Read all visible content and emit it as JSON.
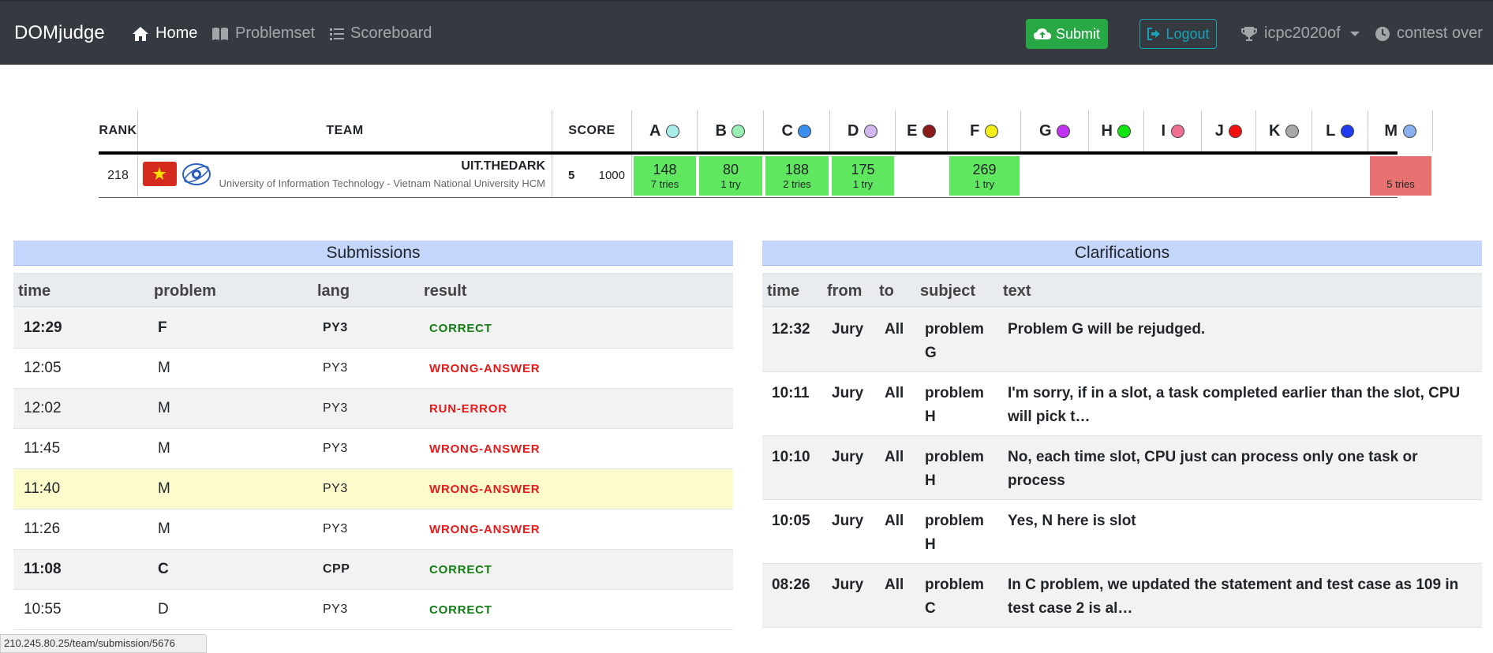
{
  "nav": {
    "brand": "DOMjudge",
    "links": [
      {
        "label": "Home",
        "icon": "home-icon"
      },
      {
        "label": "Problemset",
        "icon": "book-icon"
      },
      {
        "label": "Scoreboard",
        "icon": "list-icon"
      }
    ],
    "submit_label": "Submit",
    "logout_label": "Logout",
    "contest": "icpc2020of",
    "status": "contest over"
  },
  "scoreboard": {
    "headers": {
      "rank": "RANK",
      "team": "TEAM",
      "score": "SCORE"
    },
    "problems": [
      {
        "label": "A",
        "color": "#a8ecec"
      },
      {
        "label": "B",
        "color": "#9af0b4"
      },
      {
        "label": "C",
        "color": "#3b8ff0"
      },
      {
        "label": "D",
        "color": "#d2b8f0"
      },
      {
        "label": "E",
        "color": "#8b1a1a"
      },
      {
        "label": "F",
        "color": "#f5ee1a"
      },
      {
        "label": "G",
        "color": "#c133f0"
      },
      {
        "label": "H",
        "color": "#12e612"
      },
      {
        "label": "I",
        "color": "#f07094"
      },
      {
        "label": "J",
        "color": "#f01010"
      },
      {
        "label": "K",
        "color": "#a8a8a8"
      },
      {
        "label": "L",
        "color": "#1f3cf0"
      },
      {
        "label": "M",
        "color": "#8ab0f0"
      }
    ],
    "row": {
      "rank": "218",
      "team_name": "UIT.THEDARK",
      "affiliation": "University of Information Technology - Vietnam National University HCM",
      "solved": "5",
      "penalty": "1000",
      "cells": [
        {
          "time": "148",
          "tries": "7 tries",
          "state": "solved"
        },
        {
          "time": "80",
          "tries": "1 try",
          "state": "solved"
        },
        {
          "time": "188",
          "tries": "2 tries",
          "state": "solved"
        },
        {
          "time": "175",
          "tries": "1 try",
          "state": "solved"
        },
        {
          "time": "",
          "tries": "",
          "state": "none"
        },
        {
          "time": "269",
          "tries": "1 try",
          "state": "solved"
        },
        {
          "time": "",
          "tries": "",
          "state": "none"
        },
        {
          "time": "",
          "tries": "",
          "state": "none"
        },
        {
          "time": "",
          "tries": "",
          "state": "none"
        },
        {
          "time": "",
          "tries": "",
          "state": "none"
        },
        {
          "time": "",
          "tries": "",
          "state": "none"
        },
        {
          "time": "",
          "tries": "",
          "state": "none"
        },
        {
          "time": "",
          "tries": "5 tries",
          "state": "failed"
        }
      ]
    }
  },
  "submissions": {
    "title": "Submissions",
    "columns": [
      "time",
      "problem",
      "lang",
      "result"
    ],
    "rows": [
      {
        "time": "12:29",
        "problem": "F",
        "lang": "PY3",
        "result": "CORRECT",
        "ok": true,
        "bold": true
      },
      {
        "time": "12:05",
        "problem": "M",
        "lang": "PY3",
        "result": "WRONG-ANSWER",
        "ok": false,
        "bold": false
      },
      {
        "time": "12:02",
        "problem": "M",
        "lang": "PY3",
        "result": "RUN-ERROR",
        "ok": false,
        "bold": false
      },
      {
        "time": "11:45",
        "problem": "M",
        "lang": "PY3",
        "result": "WRONG-ANSWER",
        "ok": false,
        "bold": false
      },
      {
        "time": "11:40",
        "problem": "M",
        "lang": "PY3",
        "result": "WRONG-ANSWER",
        "ok": false,
        "bold": false
      },
      {
        "time": "11:26",
        "problem": "M",
        "lang": "PY3",
        "result": "WRONG-ANSWER",
        "ok": false,
        "bold": false
      },
      {
        "time": "11:08",
        "problem": "C",
        "lang": "CPP",
        "result": "CORRECT",
        "ok": true,
        "bold": true
      },
      {
        "time": "10:55",
        "problem": "D",
        "lang": "PY3",
        "result": "CORRECT",
        "ok": true,
        "bold": false
      }
    ]
  },
  "clarifications": {
    "title": "Clarifications",
    "columns": [
      "time",
      "from",
      "to",
      "subject",
      "text"
    ],
    "rows": [
      {
        "time": "12:32",
        "from": "Jury",
        "to": "All",
        "subject": "problem G",
        "text": "Problem G will be rejudged."
      },
      {
        "time": "10:11",
        "from": "Jury",
        "to": "All",
        "subject": "problem H",
        "text": "I'm sorry, if in a slot, a task completed earlier than the slot, CPU will pick t…"
      },
      {
        "time": "10:10",
        "from": "Jury",
        "to": "All",
        "subject": "problem H",
        "text": "No, each time slot, CPU just can process only one task or process"
      },
      {
        "time": "10:05",
        "from": "Jury",
        "to": "All",
        "subject": "problem H",
        "text": "Yes, N here is slot"
      },
      {
        "time": "08:26",
        "from": "Jury",
        "to": "All",
        "subject": "problem C",
        "text": "In C problem, we updated the statement and test case as 109 in test case 2 is al…"
      }
    ]
  },
  "statusbar": "210.245.80.25/team/submission/5676"
}
